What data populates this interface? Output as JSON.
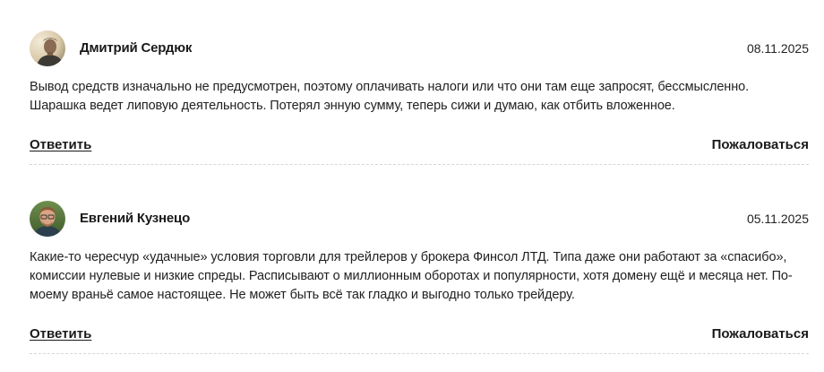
{
  "comments": [
    {
      "author": "Дмитрий Сердюк",
      "date": "08.11.2025",
      "text": "Вывод средств изначально не предусмотрен, поэтому оплачивать налоги или что они там еще запросят, бессмысленно. Шарашка ведет липовую деятельность. Потерял энную сумму, теперь сижи и думаю, как отбить вложенное.",
      "reply_label": "Ответить",
      "report_label": "Пожаловаться",
      "avatar_icon": "user-photo-avatar"
    },
    {
      "author": "Евгений Кузнецо",
      "date": "05.11.2025",
      "text": "Какие-то чересчур «удачные» условия торговли для трейлеров у брокера Финсол ЛТД. Типа даже они работают за «спасибо», комиссии нулевые и низкие спреды. Расписывают о миллионным оборотах и популярности, хотя домену ещё и месяца нет. По-моему враньё самое настоящее. Не может быть всё так гладко и выгодно только трейдеру.",
      "reply_label": "Ответить",
      "report_label": "Пожаловаться",
      "avatar_icon": "user-photo-avatar"
    }
  ],
  "colors": {
    "text": "#1f1f1f",
    "divider": "#d6d6d6",
    "background": "#ffffff"
  }
}
